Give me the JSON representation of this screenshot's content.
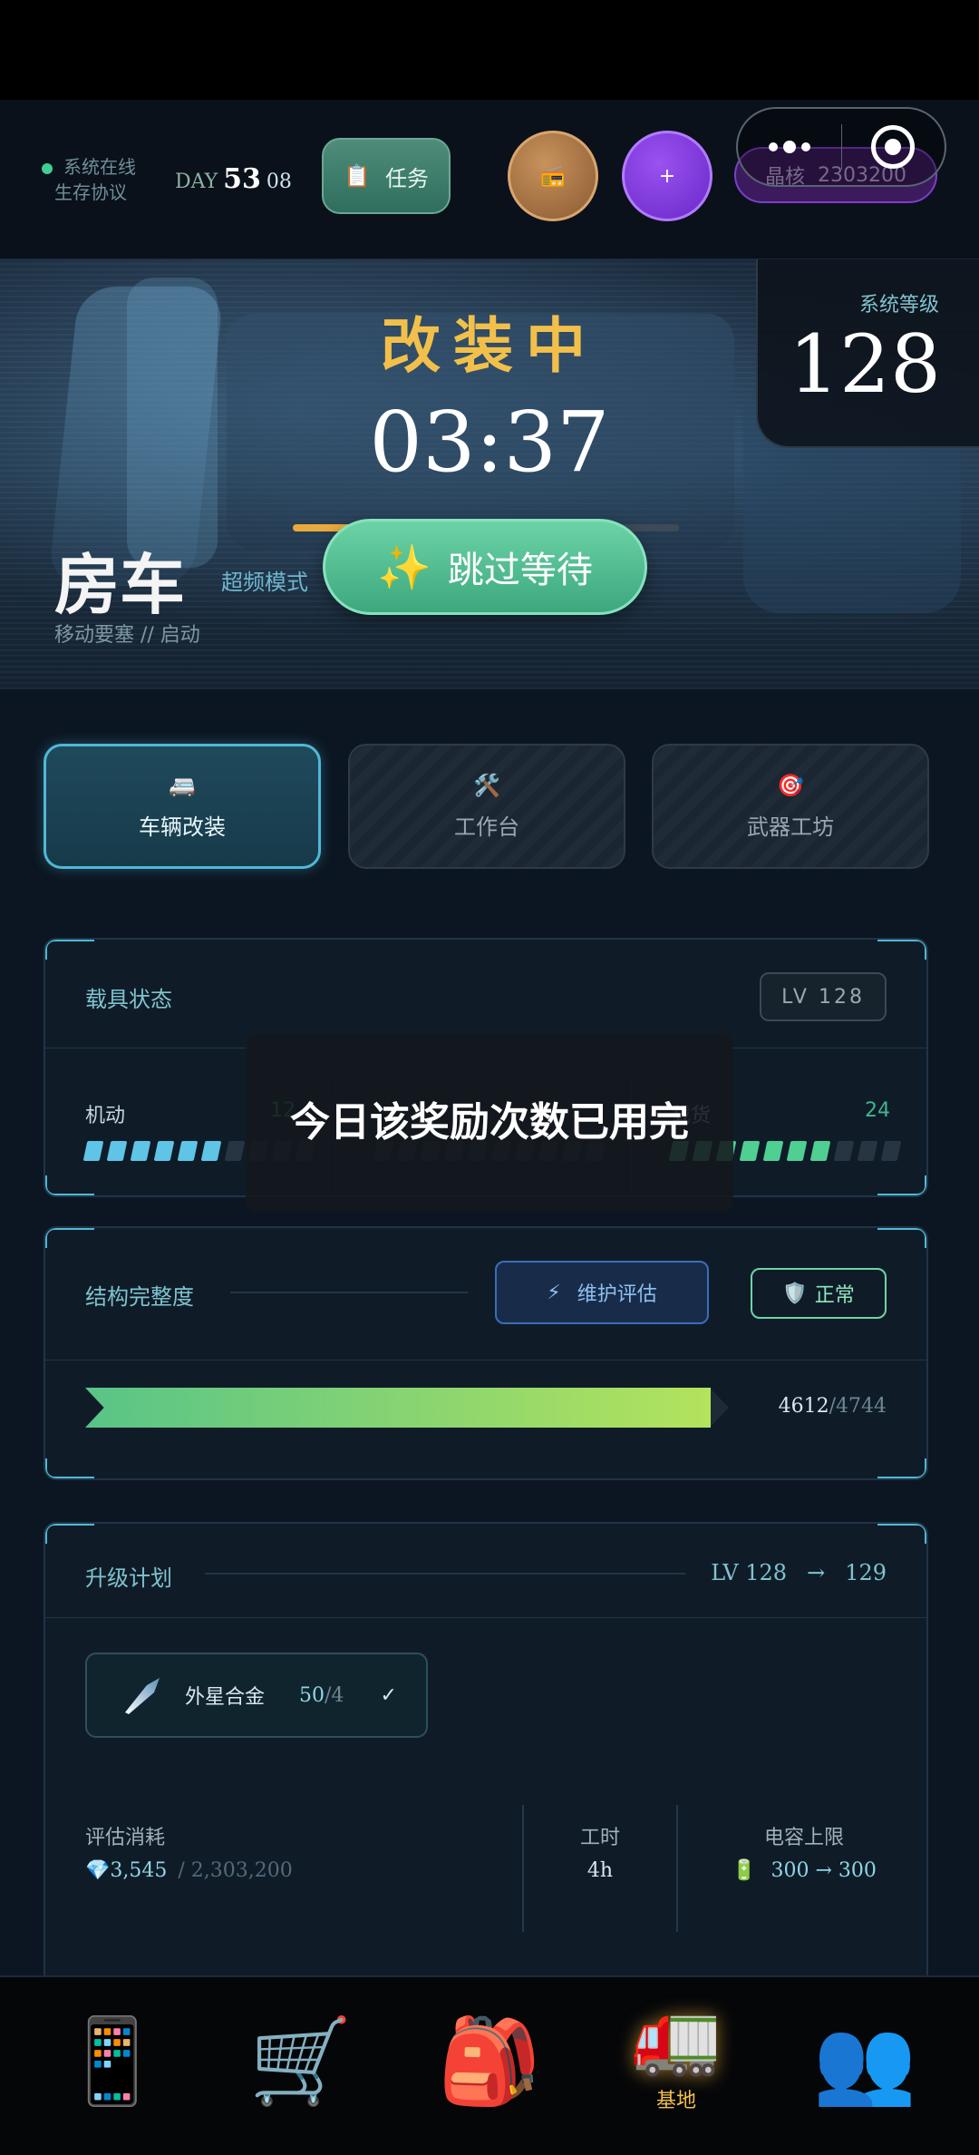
{
  "colors": {
    "accent": "#4fb8d6",
    "gold": "#f2c04a",
    "green": "#3fb58a",
    "purple": "#7c3fc8"
  },
  "topbar": {
    "status_line1": "系统在线",
    "status_line2": "生存协议",
    "day_label": "DAY",
    "day_number": "53",
    "day_sub": "08",
    "task_icon": "📋",
    "task_label": "任务",
    "radio_icon": "📻",
    "plus_icon": "+",
    "crystal_label": "晶核",
    "crystal_value": "2303200"
  },
  "hero": {
    "status": "改装中",
    "timer": "03:37",
    "progress": 0.71,
    "system_level_label": "系统等级",
    "system_level_value": "128",
    "vehicle_name": "房车",
    "mode": "超频模式",
    "subtitle": "移动要塞 // 启动",
    "skip_icon": "✨",
    "skip_label": "跳过等待"
  },
  "tabs": [
    {
      "icon": "🚐",
      "label": "车辆改装",
      "active": true
    },
    {
      "icon": "🛠️",
      "label": "工作台",
      "active": false
    },
    {
      "icon": "🎯",
      "label": "武器工坊",
      "active": false
    }
  ],
  "vehicle_status": {
    "title": "载具状态",
    "level": "LV 128",
    "stats": [
      {
        "name": "机动",
        "value": "12",
        "filled": 6,
        "total": 10,
        "color": "#5fc4e6"
      },
      {
        "name": "",
        "value": "",
        "filled": 0,
        "total": 10,
        "color": "#5a7fb8"
      },
      {
        "name": "载货",
        "value": "24",
        "filled": 7,
        "total": 10,
        "color": "#4fcf92"
      }
    ]
  },
  "integrity": {
    "title": "结构完整度",
    "maintain_icon": "⚡",
    "maintain_label": "维护评估",
    "badge_icon": "🛡️",
    "badge_label": "正常",
    "current": "4612",
    "max": "4744",
    "ratio": 0.972
  },
  "upgrade": {
    "title": "升级计划",
    "from_level": "LV 128",
    "arrow": "→",
    "to_level": "129",
    "material": {
      "name": "外星合金",
      "have": "50",
      "need": "/4",
      "check": "✓"
    },
    "cost_label": "评估消耗",
    "cost_icon": "💎",
    "cost_value": "3,545",
    "cost_max": "/ 2,303,200",
    "time_label": "工时",
    "time_value": "4h",
    "capacity_label": "电容上限",
    "capacity_icon": "🔋",
    "capacity_value": "300 → 300"
  },
  "toast": {
    "message": "今日该奖励次数已用完"
  },
  "bottom_nav": [
    {
      "icon": "📱",
      "label": ""
    },
    {
      "icon": "🛒",
      "label": ""
    },
    {
      "icon": "🎒",
      "label": ""
    },
    {
      "icon": "🚛",
      "label": "基地"
    },
    {
      "icon": "👥",
      "label": ""
    }
  ]
}
